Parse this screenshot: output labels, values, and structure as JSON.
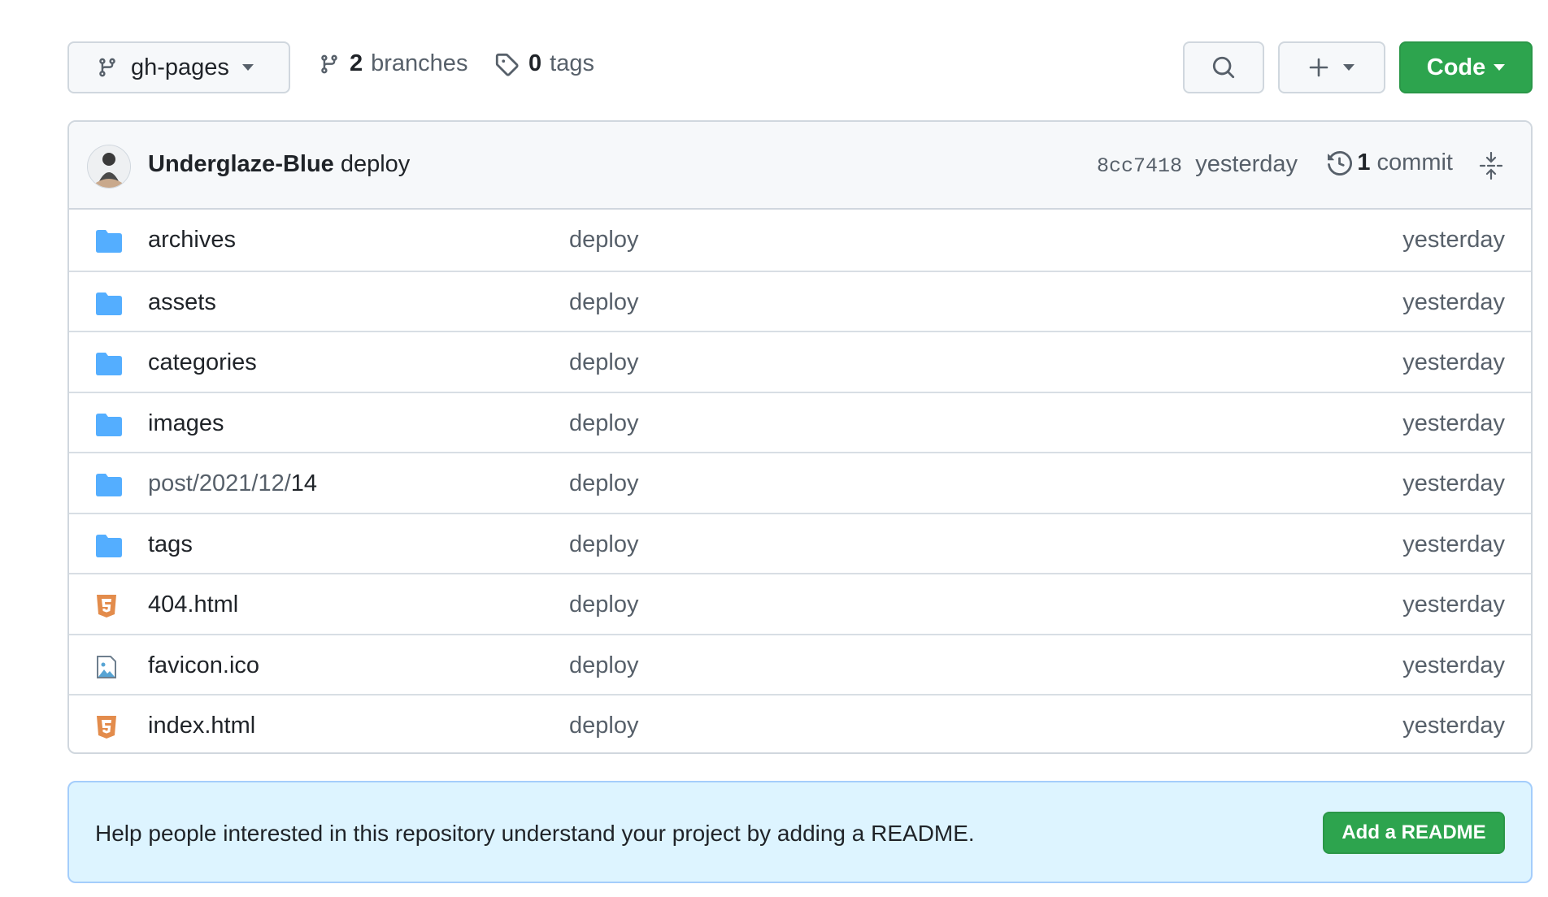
{
  "toolbar": {
    "branch_name": "gh-pages",
    "branches_count": "2",
    "branches_label": "branches",
    "tags_count": "0",
    "tags_label": "tags",
    "code_label": "Code"
  },
  "commit": {
    "author": "Underglaze-Blue",
    "message": "deploy",
    "sha": "8cc7418",
    "time": "yesterday",
    "commit_count": "1",
    "commit_label": "commit"
  },
  "files": [
    {
      "name": "archives",
      "type": "folder",
      "message": "deploy",
      "date": "yesterday"
    },
    {
      "name": "assets",
      "type": "folder",
      "message": "deploy",
      "date": "yesterday"
    },
    {
      "name": "categories",
      "type": "folder",
      "message": "deploy",
      "date": "yesterday"
    },
    {
      "name": "images",
      "type": "folder",
      "message": "deploy",
      "date": "yesterday"
    },
    {
      "name_prefix": "post/2021/12/",
      "name": "14",
      "type": "folder",
      "message": "deploy",
      "date": "yesterday"
    },
    {
      "name": "tags",
      "type": "folder",
      "message": "deploy",
      "date": "yesterday"
    },
    {
      "name": "404.html",
      "type": "html",
      "message": "deploy",
      "date": "yesterday"
    },
    {
      "name": "favicon.ico",
      "type": "image",
      "message": "deploy",
      "date": "yesterday"
    },
    {
      "name": "index.html",
      "type": "html",
      "message": "deploy",
      "date": "yesterday"
    }
  ],
  "readme_banner": {
    "text": "Help people interested in this repository understand your project by adding a README.",
    "button_label": "Add a README"
  },
  "colors": {
    "folder": "#54aeff",
    "html": "#e34c26",
    "primary_button": "#2da44e",
    "banner_bg": "#ddf4ff"
  }
}
